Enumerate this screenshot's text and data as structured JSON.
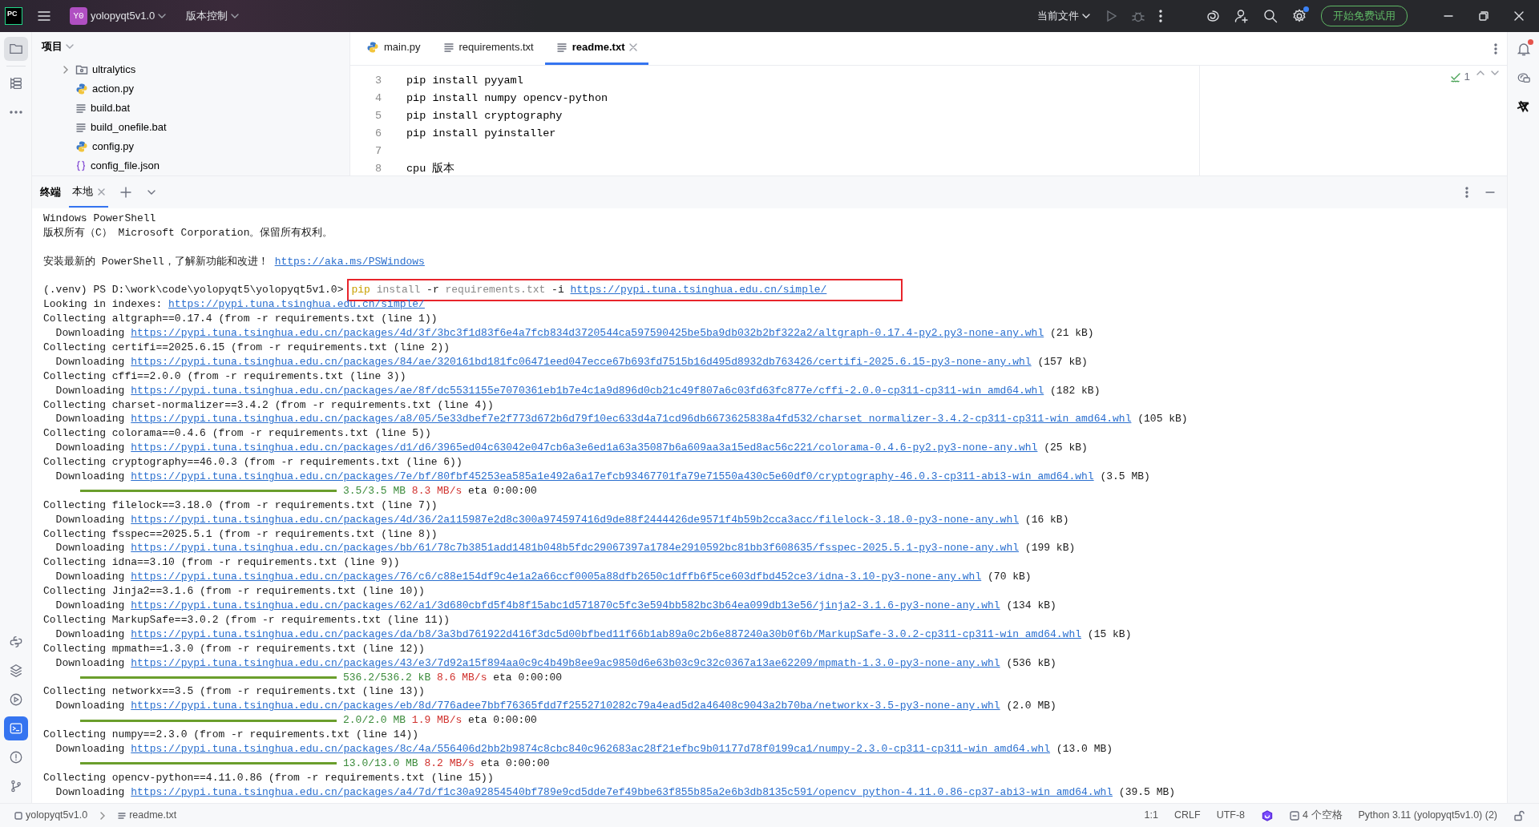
{
  "title_bar": {
    "logo": "PC",
    "project_badge": "Y0",
    "project": "yolopyqt5v1.0",
    "vcs": "版本控制",
    "run_config": "当前文件",
    "settings_update": true,
    "trial_button": "开始免费试用"
  },
  "left_toolbar": {
    "top": [
      {
        "kind": "folder",
        "selected": true
      },
      {
        "kind": "structure",
        "selected": false
      },
      {
        "kind": "more",
        "selected": false
      }
    ],
    "bottom": [
      {
        "kind": "python-console",
        "selected": false
      },
      {
        "kind": "packages",
        "selected": false
      },
      {
        "kind": "services",
        "selected": false
      },
      {
        "kind": "terminal",
        "selected": true
      },
      {
        "kind": "problems",
        "selected": false
      },
      {
        "kind": "git",
        "selected": false
      }
    ]
  },
  "project_panel": {
    "title": "项目",
    "items": [
      {
        "kind": "folder",
        "name": "ultralytics",
        "expanded": false
      },
      {
        "kind": "python",
        "name": "action.py"
      },
      {
        "kind": "text",
        "name": "build.bat"
      },
      {
        "kind": "text",
        "name": "build_onefile.bat"
      },
      {
        "kind": "python",
        "name": "config.py"
      },
      {
        "kind": "json",
        "name": "config_file.json"
      }
    ]
  },
  "tabs": [
    {
      "kind": "python",
      "label": "main.py",
      "selected": false
    },
    {
      "kind": "text",
      "label": "requirements.txt",
      "selected": false
    },
    {
      "kind": "text",
      "label": "readme.txt",
      "selected": true
    }
  ],
  "editor": {
    "inspections": "1",
    "lines": [
      {
        "number": "3",
        "text": "pip install pyyaml"
      },
      {
        "number": "4",
        "text": "pip install numpy opencv-python"
      },
      {
        "number": "5",
        "text": "pip install cryptography"
      },
      {
        "number": "6",
        "text": "pip install pyinstaller"
      },
      {
        "number": "7"
      },
      {
        "number": "8",
        "text": "cpu 版本"
      }
    ]
  },
  "notifications": {
    "unread": true
  },
  "terminal": {
    "title": "终端",
    "tabs": [
      {
        "label": "本地",
        "selected": true
      }
    ],
    "lines": [
      {
        "kind": "text",
        "text": "Windows PowerShell"
      },
      {
        "kind": "text",
        "text": "版权所有（C） Microsoft Corporation。保留所有权利。"
      },
      {
        "kind": "blank"
      },
      {
        "kind": "link_line",
        "text": "安装最新的 PowerShell，了解新功能和改进！",
        "url": "https://aka.ms/PSWindows"
      },
      {
        "kind": "blank"
      },
      {
        "kind": "prompt",
        "prompt": "(.venv) PS D:\\work\\code\\yolopyqt5\\yolopyqt5v1.0>",
        "highlighted": true,
        "tokens": [
          {
            "kind": "cmd",
            "text": "pip"
          },
          {
            "kind": "arg",
            "text": "install"
          },
          {
            "kind": "flag",
            "text": "-r"
          },
          {
            "kind": "arg",
            "text": "requirements.txt"
          },
          {
            "kind": "flag",
            "text": "-i"
          },
          {
            "kind": "link",
            "text": "https://pypi.tuna.tsinghua.edu.cn/simple/"
          }
        ]
      },
      {
        "kind": "link_line",
        "text": "Looking in indexes:",
        "url": "https://pypi.tuna.tsinghua.edu.cn/simple/"
      },
      {
        "kind": "text",
        "text": "Collecting altgraph==0.17.4 (from -r requirements.txt (line 1))"
      },
      {
        "kind": "download",
        "label": "Downloading",
        "url": "https://pypi.tuna.tsinghua.edu.cn/packages/4d/3f/3bc3f1d83f6e4a7fcb834d3720544ca597590425be5ba9db032b2bf322a2/altgraph-0.17.4-py2.py3-none-any.whl",
        "size": "(21 kB)"
      },
      {
        "kind": "text",
        "text": "Collecting certifi==2025.6.15 (from -r requirements.txt (line 2))"
      },
      {
        "kind": "download",
        "label": "Downloading",
        "url": "https://pypi.tuna.tsinghua.edu.cn/packages/84/ae/320161bd181fc06471eed047ecce67b693fd7515b16d495d8932db763426/certifi-2025.6.15-py3-none-any.whl",
        "size": "(157 kB)"
      },
      {
        "kind": "text",
        "text": "Collecting cffi==2.0.0 (from -r requirements.txt (line 3))"
      },
      {
        "kind": "download",
        "label": "Downloading",
        "url": "https://pypi.tuna.tsinghua.edu.cn/packages/ae/8f/dc5531155e7070361eb1b7e4c1a9d896d0cb21c49f807a6c03fd63fc877e/cffi-2.0.0-cp311-cp311-win_amd64.whl",
        "size": "(182 kB)"
      },
      {
        "kind": "text",
        "text": "Collecting charset-normalizer==3.4.2 (from -r requirements.txt (line 4))"
      },
      {
        "kind": "download",
        "label": "Downloading",
        "url": "https://pypi.tuna.tsinghua.edu.cn/packages/a8/05/5e33dbef7e2f773d672b6d79f10ec633d4a71cd96db6673625838a4fd532/charset_normalizer-3.4.2-cp311-cp311-win_amd64.whl",
        "size": "(105 kB)"
      },
      {
        "kind": "text",
        "text": "Collecting colorama==0.4.6 (from -r requirements.txt (line 5))"
      },
      {
        "kind": "download",
        "label": "Downloading",
        "url": "https://pypi.tuna.tsinghua.edu.cn/packages/d1/d6/3965ed04c63042e047cb6a3e6ed1a63a35087b6a609aa3a15ed8ac56c221/colorama-0.4.6-py2.py3-none-any.whl",
        "size": "(25 kB)"
      },
      {
        "kind": "text",
        "text": "Collecting cryptography==46.0.3 (from -r requirements.txt (line 6))"
      },
      {
        "kind": "download",
        "label": "Downloading",
        "url": "https://pypi.tuna.tsinghua.edu.cn/packages/7e/bf/80fbf45253ea585a1e492a6a17efcb93467701fa79e71550a430c5e60df0/cryptography-46.0.3-cp311-abi3-win_amd64.whl",
        "size": "(3.5 MB)"
      },
      {
        "kind": "progress",
        "level": 1,
        "amount": "3.5/3.5 MB",
        "speed": "8.3 MB/s",
        "eta": "eta 0:00:00"
      },
      {
        "kind": "text",
        "text": "Collecting filelock==3.18.0 (from -r requirements.txt (line 7))"
      },
      {
        "kind": "download",
        "label": "Downloading",
        "url": "https://pypi.tuna.tsinghua.edu.cn/packages/4d/36/2a115987e2d8c300a974597416d9de88f2444426de9571f4b59b2cca3acc/filelock-3.18.0-py3-none-any.whl",
        "size": "(16 kB)"
      },
      {
        "kind": "text",
        "text": "Collecting fsspec==2025.5.1 (from -r requirements.txt (line 8))"
      },
      {
        "kind": "download",
        "label": "Downloading",
        "url": "https://pypi.tuna.tsinghua.edu.cn/packages/bb/61/78c7b3851add1481b048b5fdc29067397a1784e2910592bc81bb3f608635/fsspec-2025.5.1-py3-none-any.whl",
        "size": "(199 kB)"
      },
      {
        "kind": "text",
        "text": "Collecting idna==3.10 (from -r requirements.txt (line 9))"
      },
      {
        "kind": "download",
        "label": "Downloading",
        "url": "https://pypi.tuna.tsinghua.edu.cn/packages/76/c6/c88e154df9c4e1a2a66ccf0005a88dfb2650c1dffb6f5ce603dfbd452ce3/idna-3.10-py3-none-any.whl",
        "size": "(70 kB)"
      },
      {
        "kind": "text",
        "text": "Collecting Jinja2==3.1.6 (from -r requirements.txt (line 10))"
      },
      {
        "kind": "download",
        "label": "Downloading",
        "url": "https://pypi.tuna.tsinghua.edu.cn/packages/62/a1/3d680cbfd5f4b8f15abc1d571870c5fc3e594bb582bc3b64ea099db13e56/jinja2-3.1.6-py3-none-any.whl",
        "size": "(134 kB)"
      },
      {
        "kind": "text",
        "text": "Collecting MarkupSafe==3.0.2 (from -r requirements.txt (line 11))"
      },
      {
        "kind": "download",
        "label": "Downloading",
        "url": "https://pypi.tuna.tsinghua.edu.cn/packages/da/b8/3a3bd761922d416f3dc5d00bfbed11f66b1ab89a0c2b6e887240a30b0f6b/MarkupSafe-3.0.2-cp311-cp311-win_amd64.whl",
        "size": "(15 kB)"
      },
      {
        "kind": "text",
        "text": "Collecting mpmath==1.3.0 (from -r requirements.txt (line 12))"
      },
      {
        "kind": "download",
        "label": "Downloading",
        "url": "https://pypi.tuna.tsinghua.edu.cn/packages/43/e3/7d92a15f894aa0c9c4b49b8ee9ac9850d6e63b03c9c32c0367a13ae62209/mpmath-1.3.0-py3-none-any.whl",
        "size": "(536 kB)"
      },
      {
        "kind": "progress",
        "level": 1,
        "amount": "536.2/536.2 kB",
        "speed": "8.6 MB/s",
        "eta": "eta 0:00:00"
      },
      {
        "kind": "text",
        "text": "Collecting networkx==3.5 (from -r requirements.txt (line 13))"
      },
      {
        "kind": "download",
        "label": "Downloading",
        "url": "https://pypi.tuna.tsinghua.edu.cn/packages/eb/8d/776adee7bbf76365fdd7f2552710282c79a4ead5d2a46408c9043a2b70ba/networkx-3.5-py3-none-any.whl",
        "size": "(2.0 MB)"
      },
      {
        "kind": "progress",
        "level": 1,
        "amount": "2.0/2.0 MB",
        "speed": "1.9 MB/s",
        "eta": "eta 0:00:00"
      },
      {
        "kind": "text",
        "text": "Collecting numpy==2.3.0 (from -r requirements.txt (line 14))"
      },
      {
        "kind": "download",
        "label": "Downloading",
        "url": "https://pypi.tuna.tsinghua.edu.cn/packages/8c/4a/556406d2bb2b9874c8cbc840c962683ac28f21efbc9b01177d78f0199ca1/numpy-2.3.0-cp311-cp311-win_amd64.whl",
        "size": "(13.0 MB)"
      },
      {
        "kind": "progress",
        "level": 1,
        "amount": "13.0/13.0 MB",
        "speed": "8.2 MB/s",
        "eta": "eta 0:00:00"
      },
      {
        "kind": "text",
        "text": "Collecting opencv-python==4.11.0.86 (from -r requirements.txt (line 15))"
      },
      {
        "kind": "download",
        "label": "Downloading",
        "url": "https://pypi.tuna.tsinghua.edu.cn/packages/a4/7d/f1c30a92854540bf789e9cd5dde7ef49bbe63f855b85a2e6b3db8135c591/opencv_python-4.11.0.86-cp37-abi3-win_amd64.whl",
        "size": "(39.5 MB)"
      }
    ]
  },
  "status_bar": {
    "breadcrumbs": [
      "yolopyqt5v1.0",
      "readme.txt"
    ],
    "position": "1:1",
    "line_separator": "CRLF",
    "encoding": "UTF-8",
    "indent": "4 个空格",
    "interpreter": "Python 3.11 (yolopyqt5v1.0) (2)"
  }
}
